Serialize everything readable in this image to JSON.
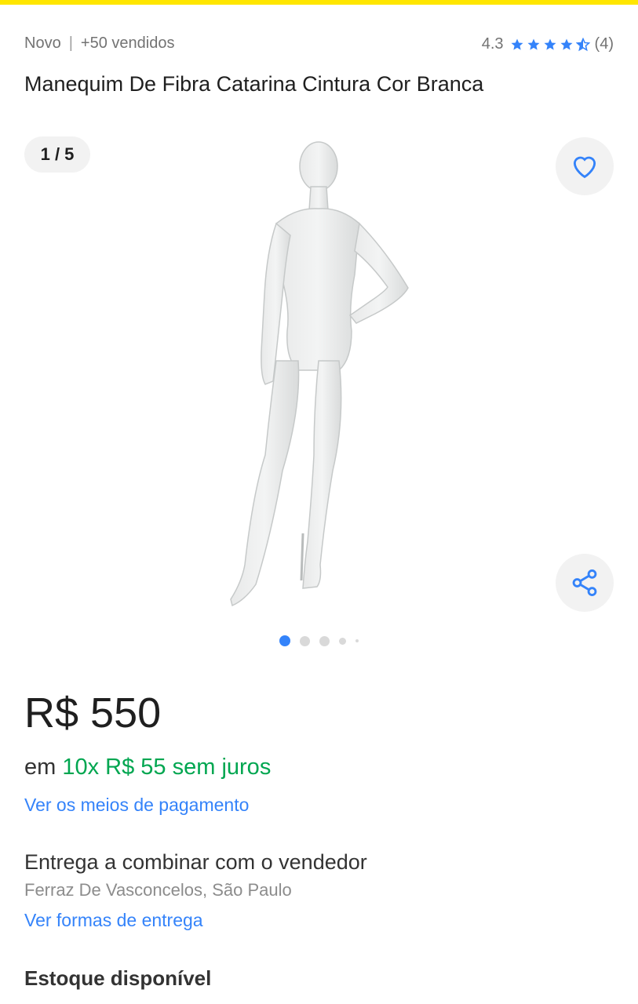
{
  "colors": {
    "accent": "#3483fa",
    "green": "#00a650",
    "brand_yellow": "#ffe600"
  },
  "product": {
    "condition": "Novo",
    "sold": "+50 vendidos",
    "rating": "4.3",
    "rating_value": 4.3,
    "review_count": "(4)",
    "title": "Manequim De Fibra Catarina Cintura Cor Branca"
  },
  "gallery": {
    "counter": "1 / 5",
    "current": 1,
    "total": 5,
    "image": "white-mannequin-photo",
    "favorite_icon": "heart-icon",
    "share_icon": "share-icon"
  },
  "pricing": {
    "price": "R$ 550",
    "installments_prefix": "em",
    "installments_value": "10x R$ 55 sem juros",
    "payment_link": "Ver os meios de pagamento"
  },
  "shipping": {
    "title": "Entrega a combinar com o vendedor",
    "location": "Ferraz De Vasconcelos, São Paulo",
    "link": "Ver formas de entrega"
  },
  "stock": {
    "title": "Estoque disponível"
  }
}
